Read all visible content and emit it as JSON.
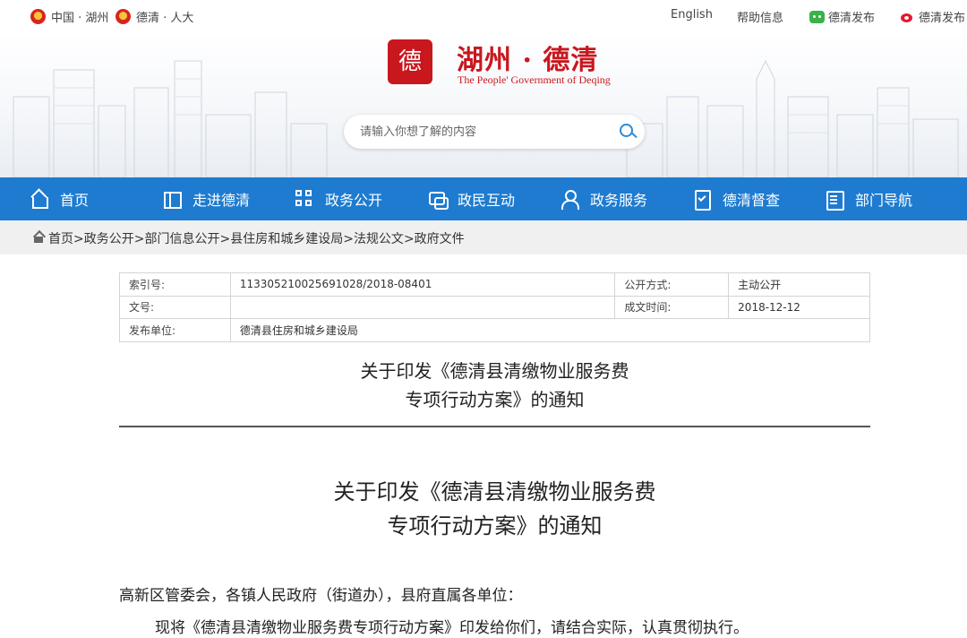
{
  "topbar": {
    "site1": "中国 · 湖州",
    "site2": "德清 · 人大",
    "english": "English",
    "help": "帮助信息",
    "wechat": "德清发布",
    "weibo": "德清发布"
  },
  "header": {
    "seal_text": "德",
    "title": "湖州 · 德清",
    "subtitle": "The People' Government of Deqing",
    "search_placeholder": "请输入你想了解的内容"
  },
  "nav": {
    "items": [
      {
        "label": "首页",
        "icon": "home-icon"
      },
      {
        "label": "走进德清",
        "icon": "map-icon"
      },
      {
        "label": "政务公开",
        "icon": "grid-icon"
      },
      {
        "label": "政民互动",
        "icon": "chat-icon"
      },
      {
        "label": "政务服务",
        "icon": "user-icon"
      },
      {
        "label": "德清督查",
        "icon": "check-icon"
      },
      {
        "label": "部门导航",
        "icon": "list-icon"
      }
    ],
    "bg_color": "#1e7bd0"
  },
  "breadcrumb": {
    "items": [
      "首页",
      "政务公开",
      "部门信息公开",
      "县住房和城乡建设局",
      "法规公文",
      "政府文件"
    ],
    "separator": ">"
  },
  "meta": {
    "index_label": "索引号:",
    "index_value": "113305210025691028/2018-08401",
    "public_label": "公开方式:",
    "public_value": "主动公开",
    "docno_label": "文号:",
    "docno_value": "",
    "date_label": "成文时间:",
    "date_value": "2018-12-12",
    "issuer_label": "发布单位:",
    "issuer_value": "德清县住房和城乡建设局"
  },
  "doc": {
    "title_line1": "关于印发《德清县清缴物业服务费",
    "title_line2": "专项行动方案》的通知",
    "body_title_line1": "关于印发《德清县清缴物业服务费",
    "body_title_line2": "专项行动方案》的通知",
    "salutation": "高新区管委会，各镇人民政府（街道办），县府直属各单位：",
    "para1": "现将《德清县清缴物业服务费专项行动方案》印发给你们，请结合实际，认真贯彻执行。"
  }
}
